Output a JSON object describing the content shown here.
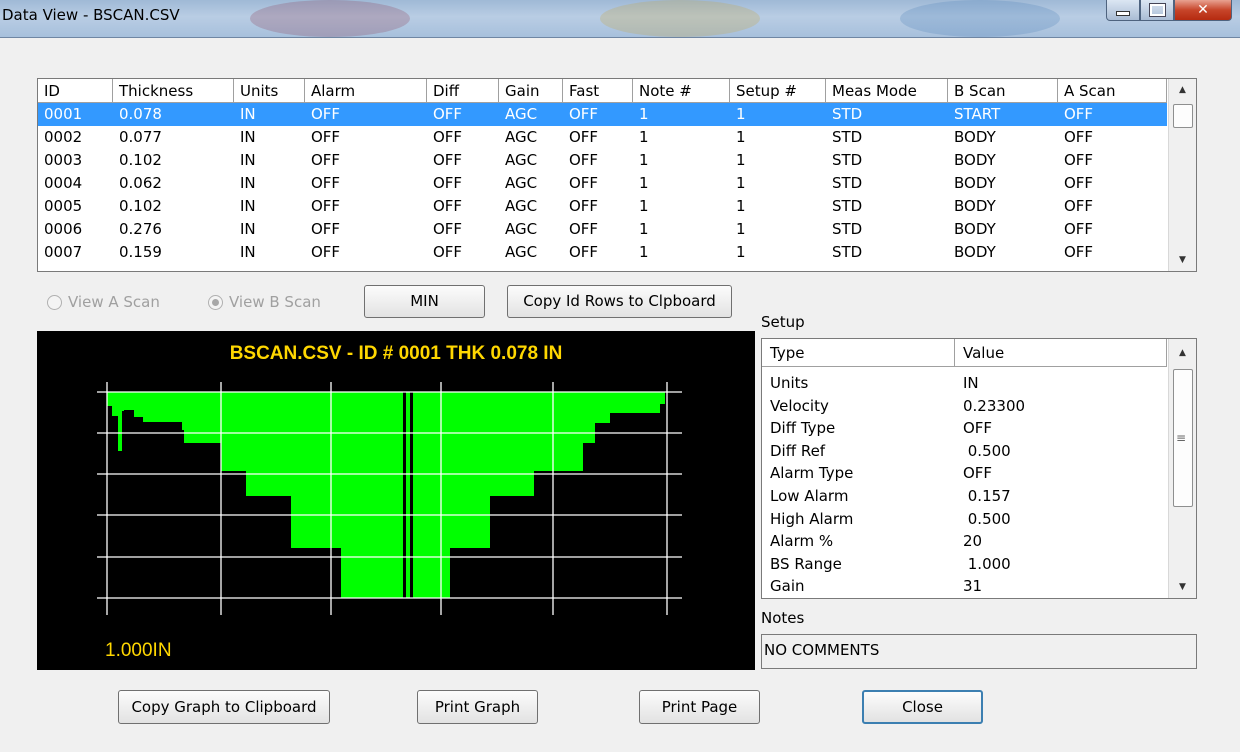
{
  "window": {
    "title": "Data View - BSCAN.CSV"
  },
  "table": {
    "columns": [
      "ID",
      "Thickness",
      "Units",
      "Alarm",
      "Diff",
      "Gain",
      "Fast",
      "Note #",
      "Setup #",
      "Meas Mode",
      "B Scan",
      "A Scan"
    ],
    "rows": [
      [
        "0001",
        "0.078",
        "IN",
        "OFF",
        "OFF",
        "AGC",
        "OFF",
        "1",
        "1",
        "STD",
        "START",
        "OFF"
      ],
      [
        "0002",
        "0.077",
        "IN",
        "OFF",
        "OFF",
        "AGC",
        "OFF",
        "1",
        "1",
        "STD",
        "BODY",
        "OFF"
      ],
      [
        "0003",
        "0.102",
        "IN",
        "OFF",
        "OFF",
        "AGC",
        "OFF",
        "1",
        "1",
        "STD",
        "BODY",
        "OFF"
      ],
      [
        "0004",
        "0.062",
        "IN",
        "OFF",
        "OFF",
        "AGC",
        "OFF",
        "1",
        "1",
        "STD",
        "BODY",
        "OFF"
      ],
      [
        "0005",
        "0.102",
        "IN",
        "OFF",
        "OFF",
        "AGC",
        "OFF",
        "1",
        "1",
        "STD",
        "BODY",
        "OFF"
      ],
      [
        "0006",
        "0.276",
        "IN",
        "OFF",
        "OFF",
        "AGC",
        "OFF",
        "1",
        "1",
        "STD",
        "BODY",
        "OFF"
      ],
      [
        "0007",
        "0.159",
        "IN",
        "OFF",
        "OFF",
        "AGC",
        "OFF",
        "1",
        "1",
        "STD",
        "BODY",
        "OFF"
      ]
    ],
    "selected_row": 0
  },
  "controls": {
    "view_a_scan": "View A Scan",
    "view_b_scan": "View B Scan",
    "min_button": "MIN",
    "copy_id_rows_button": "Copy Id Rows to Clpboard"
  },
  "graph": {
    "title": "BSCAN.CSV - ID # 0001 THK  0.078 IN",
    "range_label": "1.000IN",
    "colors": {
      "background": "#000000",
      "fill": "#00ff00",
      "grid": "#ffffff",
      "text": "#ffd700"
    }
  },
  "setup": {
    "label": "Setup",
    "columns": [
      "Type",
      "Value"
    ],
    "rows": [
      [
        "Units",
        "IN"
      ],
      [
        "Velocity",
        "0.23300"
      ],
      [
        "Diff Type",
        "OFF"
      ],
      [
        "Diff Ref",
        " 0.500"
      ],
      [
        "Alarm Type",
        "OFF"
      ],
      [
        "Low Alarm",
        " 0.157"
      ],
      [
        "High Alarm",
        " 0.500"
      ],
      [
        "Alarm %",
        "20"
      ],
      [
        "BS Range",
        " 1.000"
      ],
      [
        "Gain",
        "31"
      ]
    ]
  },
  "notes": {
    "label": "Notes",
    "value": "NO COMMENTS"
  },
  "buttons": {
    "copy_graph": "Copy Graph to Clipboard",
    "print_graph": "Print Graph",
    "print_page": "Print Page",
    "close": "Close"
  }
}
